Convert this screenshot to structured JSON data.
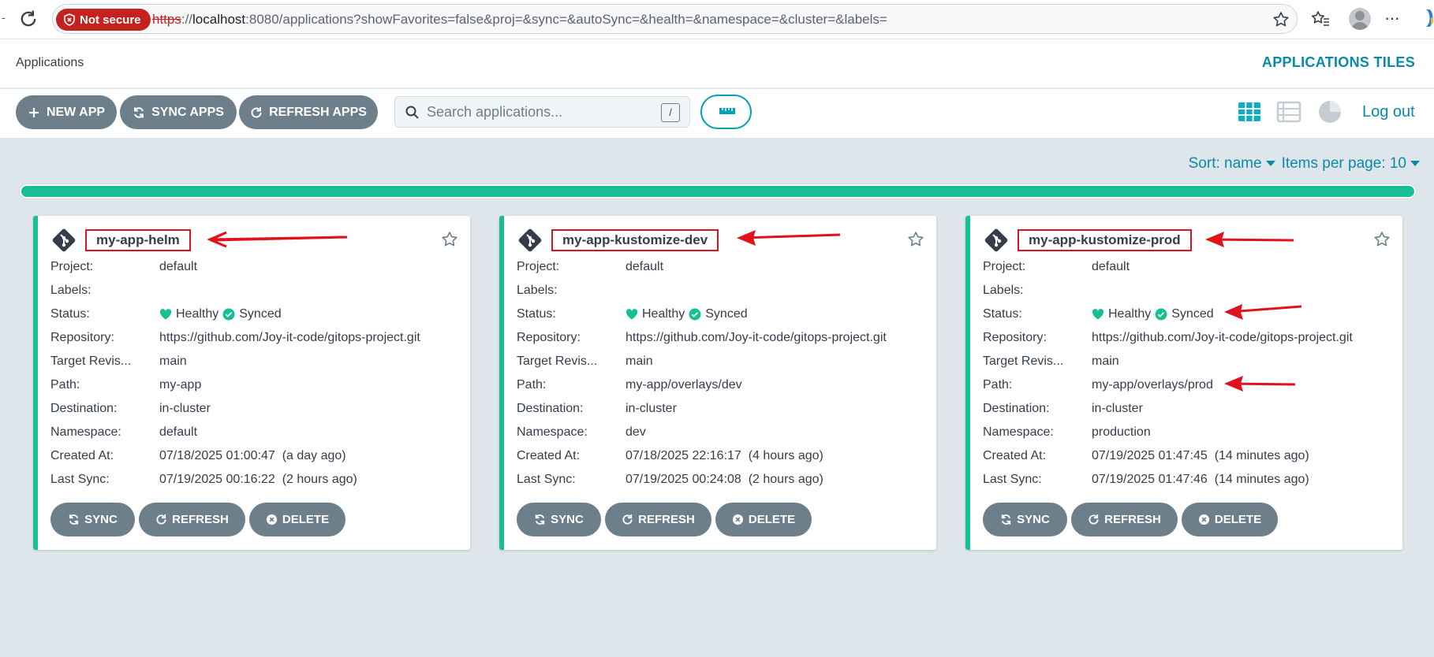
{
  "browser": {
    "security_label": "Not secure",
    "url_scheme": "https",
    "url_sep": "://",
    "url_host": "localhost",
    "url_rest": ":8080/applications?showFavorites=false&proj=&sync=&autoSync=&health=&namespace=&cluster=&labels="
  },
  "app": {
    "title": "Applications",
    "tiles_label": "APPLICATIONS TILES"
  },
  "toolbar": {
    "new_app": "NEW APP",
    "sync_apps": "SYNC APPS",
    "refresh_apps": "REFRESH APPS",
    "search_placeholder": "Search applications...",
    "search_shortcut": "/",
    "logout": "Log out"
  },
  "list": {
    "sort_label": "Sort: name",
    "per_page_label": "Items per page: 10",
    "progress_fraction": 1.0
  },
  "field_labels": {
    "project": "Project:",
    "labels": "Labels:",
    "status": "Status:",
    "repository": "Repository:",
    "target_revision": "Target Revis...",
    "path": "Path:",
    "destination": "Destination:",
    "namespace": "Namespace:",
    "created_at": "Created At:",
    "last_sync": "Last Sync:"
  },
  "card_actions": {
    "sync": "SYNC",
    "refresh": "REFRESH",
    "delete": "DELETE"
  },
  "apps": [
    {
      "name": "my-app-helm",
      "project": "default",
      "labels": "",
      "health": "Healthy",
      "sync": "Synced",
      "repository": "https://github.com/Joy-it-code/gitops-project.git",
      "target_revision": "main",
      "path": "my-app",
      "destination": "in-cluster",
      "namespace": "default",
      "created_at": "07/18/2025 01:00:47  (a day ago)",
      "last_sync": "07/19/2025 00:16:22  (2 hours ago)"
    },
    {
      "name": "my-app-kustomize-dev",
      "project": "default",
      "labels": "",
      "health": "Healthy",
      "sync": "Synced",
      "repository": "https://github.com/Joy-it-code/gitops-project.git",
      "target_revision": "main",
      "path": "my-app/overlays/dev",
      "destination": "in-cluster",
      "namespace": "dev",
      "created_at": "07/18/2025 22:16:17  (4 hours ago)",
      "last_sync": "07/19/2025 00:24:08  (2 hours ago)"
    },
    {
      "name": "my-app-kustomize-prod",
      "project": "default",
      "labels": "",
      "health": "Healthy",
      "sync": "Synced",
      "repository": "https://github.com/Joy-it-code/gitops-project.git",
      "target_revision": "main",
      "path": "my-app/overlays/prod",
      "destination": "in-cluster",
      "namespace": "production",
      "created_at": "07/19/2025 01:47:45  (14 minutes ago)",
      "last_sync": "07/19/2025 01:47:46  (14 minutes ago)"
    }
  ],
  "colors": {
    "accent": "#0a8aa8",
    "healthy": "#18be94",
    "button": "#6d7f8b",
    "annotation": "#e0121b"
  }
}
